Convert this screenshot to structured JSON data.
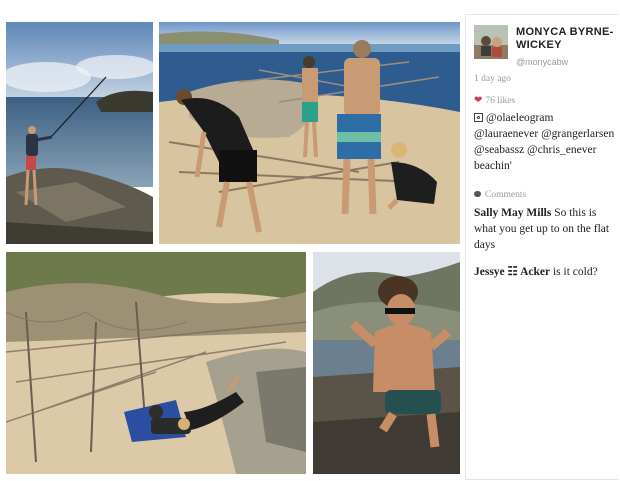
{
  "post": {
    "user_name": "MONYCA BYRNE-WICKEY",
    "user_handle": "@monycabw",
    "time": "1 day ago",
    "likes": "76 likes",
    "caption": "@olaeleogram @lauraenever @grangerlarsen @seabassz @chris_enever beachin'"
  },
  "comments_heading": "Comments",
  "comments": [
    {
      "author": "Sally May Mills",
      "text": "So this is what you get up to on the flat days"
    },
    {
      "author": "Jessye ☷ Acker",
      "text": "is it cold?"
    }
  ],
  "icons": {
    "like": "heart-icon",
    "caption": "photo-icon",
    "comments": "comment-bubble-icon"
  },
  "colors": {
    "heart": "#d8343d",
    "meta_text": "#9a9a9a",
    "body_text": "#222222"
  }
}
